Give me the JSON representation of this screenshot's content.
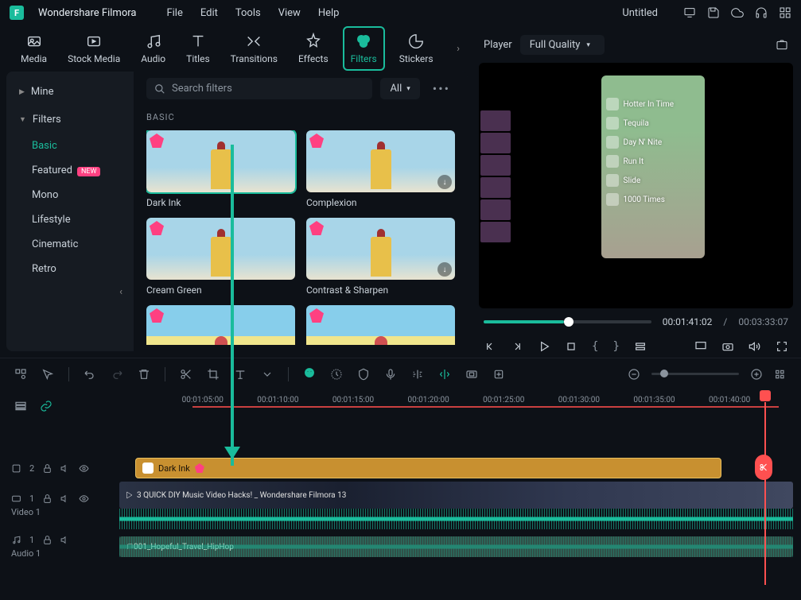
{
  "titlebar": {
    "appname": "Wondershare Filmora",
    "menus": [
      "File",
      "Edit",
      "Tools",
      "View",
      "Help"
    ],
    "project": "Untitled"
  },
  "mediatabs": [
    {
      "id": "media",
      "label": "Media"
    },
    {
      "id": "stock",
      "label": "Stock Media"
    },
    {
      "id": "audio",
      "label": "Audio"
    },
    {
      "id": "titles",
      "label": "Titles"
    },
    {
      "id": "transitions",
      "label": "Transitions"
    },
    {
      "id": "effects",
      "label": "Effects"
    },
    {
      "id": "filters",
      "label": "Filters"
    },
    {
      "id": "stickers",
      "label": "Stickers"
    }
  ],
  "sidebar": {
    "top1": "Mine",
    "top2": "Filters",
    "subs": [
      "Basic",
      "Featured",
      "Mono",
      "Lifestyle",
      "Cinematic",
      "Retro"
    ],
    "active": "Basic",
    "featured_new": "NEW"
  },
  "search": {
    "placeholder": "Search filters",
    "dropdown": "All"
  },
  "section": "BASIC",
  "cards": [
    {
      "label": "Dark Ink",
      "selected": true
    },
    {
      "label": "Complexion"
    },
    {
      "label": "Cream Green"
    },
    {
      "label": "Contrast & Sharpen"
    },
    {
      "label": ""
    },
    {
      "label": ""
    }
  ],
  "player": {
    "title": "Player",
    "quality": "Full Quality",
    "items": [
      "Hotter In Time",
      "Tequila",
      "Day N' Nite",
      "Run It",
      "Slide",
      "1000 Times"
    ],
    "current": "00:01:41:02",
    "duration": "00:03:33:07"
  },
  "ruler": [
    "00:01:05:00",
    "00:01:10:00",
    "00:01:15:00",
    "00:01:20:00",
    "00:01:25:00",
    "00:01:30:00",
    "00:01:35:00",
    "00:01:40:00"
  ],
  "tracks": {
    "filter_clip": "Dark Ink",
    "video_label": "Video 1",
    "video_clip": "3 QUICK DIY Music Video Hacks! _ Wondershare Filmora 13",
    "audio_label": "Audio 1",
    "audio_clip": "001_Hopeful_Travel_HipHop"
  }
}
